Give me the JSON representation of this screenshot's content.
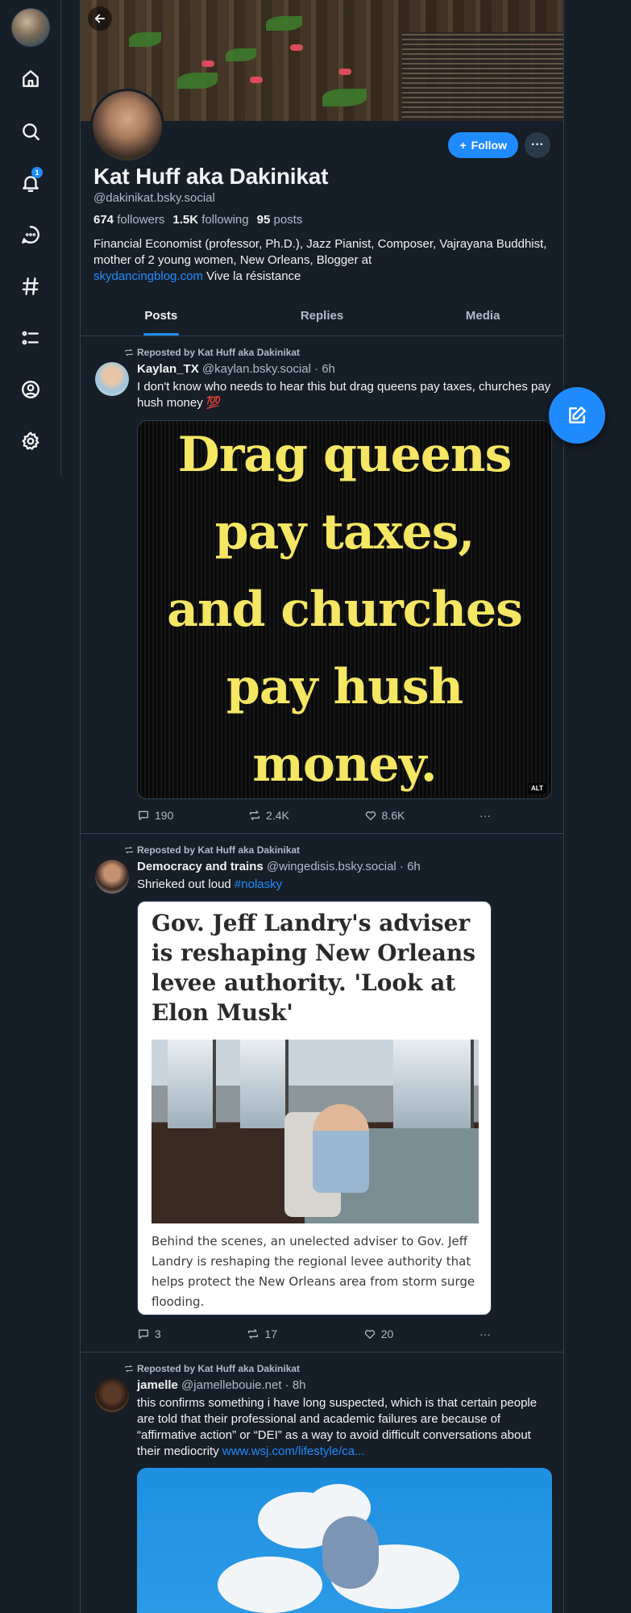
{
  "profile": {
    "display_name": "Kat Huff aka Dakinikat",
    "handle": "@dakinikat.bsky.social",
    "followers_count": "674",
    "followers_label": "followers",
    "following_count": "1.5K",
    "following_label": "following",
    "posts_count": "95",
    "posts_label": "posts",
    "bio_text": "Financial Economist (professor, Ph.D.), Jazz Pianist, Composer, Vajrayana Buddhist, mother of 2 young women, New Orleans, Blogger at",
    "bio_link": "skydancingblog.com",
    "bio_tail": " Vive la résistance",
    "follow_label": "Follow",
    "more_label": "···"
  },
  "nav": {
    "notification_count": "1",
    "icons": [
      "home-icon",
      "search-icon",
      "bell-icon",
      "chat-icon",
      "hashtag-icon",
      "list-icon",
      "profile-icon",
      "gear-icon"
    ]
  },
  "tabs": [
    {
      "label": "Posts",
      "active": true
    },
    {
      "label": "Replies",
      "active": false
    },
    {
      "label": "Media",
      "active": false
    }
  ],
  "posts": [
    {
      "repost_label": "Reposted by Kat Huff aka Dakinikat",
      "author": "Kaylan_TX",
      "meta": "@kaylan.bsky.social · 6h",
      "text": "I don't know who needs to hear this but drag queens pay taxes, churches pay hush money 💯",
      "image_lines": [
        "Drag queens",
        "pay taxes,",
        "and churches",
        "pay hush",
        "money."
      ],
      "alt_badge": "ALT",
      "replies": "190",
      "reposts": "2.4K",
      "likes": "8.6K"
    },
    {
      "repost_label": "Reposted by Kat Huff aka Dakinikat",
      "author": "Democracy and trains",
      "meta": "@wingedisis.bsky.social · 6h",
      "text": "Shrieked out loud ",
      "hashtag": "#nolasky",
      "card_headline": "Gov. Jeff Landry's adviser is reshaping New Orleans levee authority. 'Look at Elon Musk'",
      "card_description": "Behind the scenes, an unelected adviser to Gov. Jeff Landry is reshaping the regional levee authority that helps protect the New Orleans area from storm surge flooding.",
      "replies": "3",
      "reposts": "17",
      "likes": "20"
    },
    {
      "repost_label": "Reposted by Kat Huff aka Dakinikat",
      "author": "jamelle",
      "meta": "@jamellebouie.net · 8h",
      "text": "this confirms something i have long suspected, which is that certain people are told that their professional and academic failures are because of “affirmative action” or “DEI” as a way to avoid difficult conversations about their mediocrity ",
      "link": "www.wsj.com/lifestyle/ca..."
    }
  ],
  "colors": {
    "background": "#161e27",
    "accent": "#208bfe",
    "muted_text": "#aebbc9",
    "border": "#2e4052",
    "image_text_yellow": "#f5e663"
  }
}
